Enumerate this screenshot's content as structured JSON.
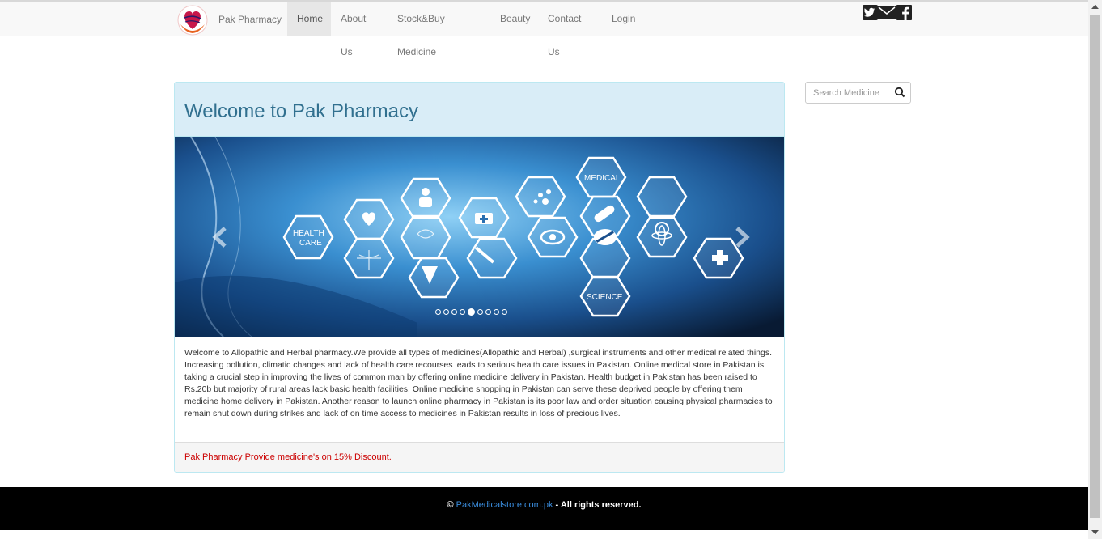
{
  "navbar": {
    "brand": "Pak Pharmacy",
    "items": [
      {
        "label": "Home",
        "active": true
      },
      {
        "label": "About Us",
        "active": false
      },
      {
        "label": "Stock&Buy Medicine",
        "active": false
      },
      {
        "label": "Beauty",
        "active": false
      },
      {
        "label": "Contact Us",
        "active": false
      },
      {
        "label": "Login",
        "active": false
      }
    ],
    "social_icons": [
      "twitter-icon",
      "mail-icon",
      "facebook-icon"
    ]
  },
  "search": {
    "placeholder": "Search Medicine",
    "icon": "search-icon"
  },
  "main": {
    "title": "Welcome to Pak Pharmacy",
    "carousel": {
      "slide_count": 9,
      "active_slide": 5,
      "labels": {
        "medical": "MEDICAL",
        "health_care_1": "HEALTH",
        "health_care_2": "CARE",
        "science": "SCIENCE"
      }
    },
    "body": "Welcome to Allopathic and Herbal pharmacy.We provide all types of medicines(Allopathic and Herbal) ,surgical instruments and other medical related things. Increasing pollution, climatic changes and lack of health care recourses leads to serious health care issues in Pakistan. Online medical store in Pakistan is taking a crucial step in improving the lives of common man by offering online medicine delivery in Pakistan. Health budget in Pakistan has been raised to Rs.20b but majority of rural areas lack basic health facilities. Online medicine shopping in Pakistan can serve these deprived people by offering them medicine home delivery in Pakistan. Another reason to launch online pharmacy in Pakistan is its poor law and order situation causing physical pharmacies to remain shut down during strikes and lack of on time access to medicines in Pakistan results in loss of precious lives.",
    "footer_note": "Pak Pharmacy Provide medicine's on 15% Discount."
  },
  "footer": {
    "copyright_symbol": "©",
    "site_link": "PakMedicalstore.com.pk",
    "rights": " - All rights reserved."
  },
  "colors": {
    "panel_heading_bg": "#d9edf7",
    "panel_title": "#31708f",
    "discount_text": "#cc0000",
    "footer_bg": "#000000",
    "link": "#3a8dde"
  }
}
